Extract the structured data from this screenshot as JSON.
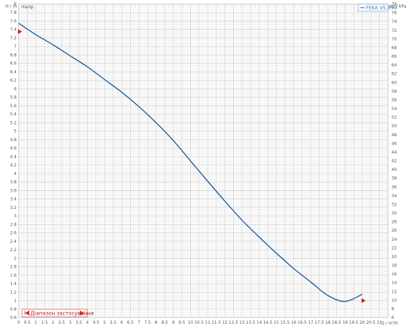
{
  "chart_data": {
    "type": "line",
    "curve_label": "Напір",
    "y_axis_left_label": "H / m",
    "y_axis_right_label": "Δp / kPa",
    "x_axis_label": "Q / m³/h",
    "legend_entry": "FEKA VS 550",
    "range_label": "Діапазон застосування",
    "xlim": [
      0,
      21.5
    ],
    "ylim": [
      0.6,
      8
    ],
    "ylim_right": [
      6,
      78
    ],
    "x_ticks": [
      0,
      0.5,
      1,
      1.5,
      2,
      2.5,
      3,
      3.5,
      4,
      4.5,
      5,
      5.5,
      6,
      6.5,
      7,
      7.5,
      8,
      8.5,
      9,
      9.5,
      10,
      10.5,
      11,
      11.5,
      12,
      12.5,
      13,
      13.5,
      14,
      14.5,
      15,
      15.5,
      16,
      16.5,
      17,
      17.5,
      18,
      18.5,
      19,
      19.5,
      20,
      20.5,
      21
    ],
    "y_ticks_left": [
      0.6,
      0.8,
      1,
      1.2,
      1.4,
      1.6,
      1.8,
      2,
      2.2,
      2.4,
      2.6,
      2.8,
      3,
      3.2,
      3.4,
      3.6,
      3.8,
      4,
      4.2,
      4.4,
      4.6,
      4.8,
      5,
      5.2,
      5.4,
      5.6,
      5.8,
      6,
      6.2,
      6.4,
      6.6,
      6.8,
      7,
      7.2,
      7.4,
      7.6,
      7.8,
      8
    ],
    "y_ticks_right": [
      6,
      8,
      10,
      12,
      14,
      16,
      18,
      20,
      22,
      24,
      26,
      28,
      30,
      32,
      34,
      36,
      38,
      40,
      42,
      44,
      46,
      48,
      50,
      52,
      54,
      56,
      58,
      60,
      62,
      64,
      66,
      68,
      70,
      72,
      74,
      76,
      78
    ],
    "grid": true,
    "legend_position": "top-right",
    "series": [
      {
        "name": "FEKA VS 550",
        "color": "#1a5a96",
        "x": [
          0,
          1,
          2,
          3,
          4,
          5,
          6,
          7,
          8,
          9,
          10,
          11,
          12,
          13,
          14,
          15,
          16,
          17,
          18,
          19,
          20
        ],
        "y": [
          7.55,
          7.28,
          7.04,
          6.78,
          6.52,
          6.22,
          5.92,
          5.58,
          5.2,
          4.78,
          4.3,
          3.82,
          3.35,
          2.9,
          2.5,
          2.12,
          1.76,
          1.44,
          1.12,
          0.98,
          1.15
        ]
      }
    ],
    "markers": [
      {
        "x": 0,
        "y": 7.35,
        "color": "#d62020",
        "direction": "right"
      },
      {
        "x": 20,
        "y": 1.0,
        "color": "#d62020",
        "direction": "right"
      }
    ]
  }
}
